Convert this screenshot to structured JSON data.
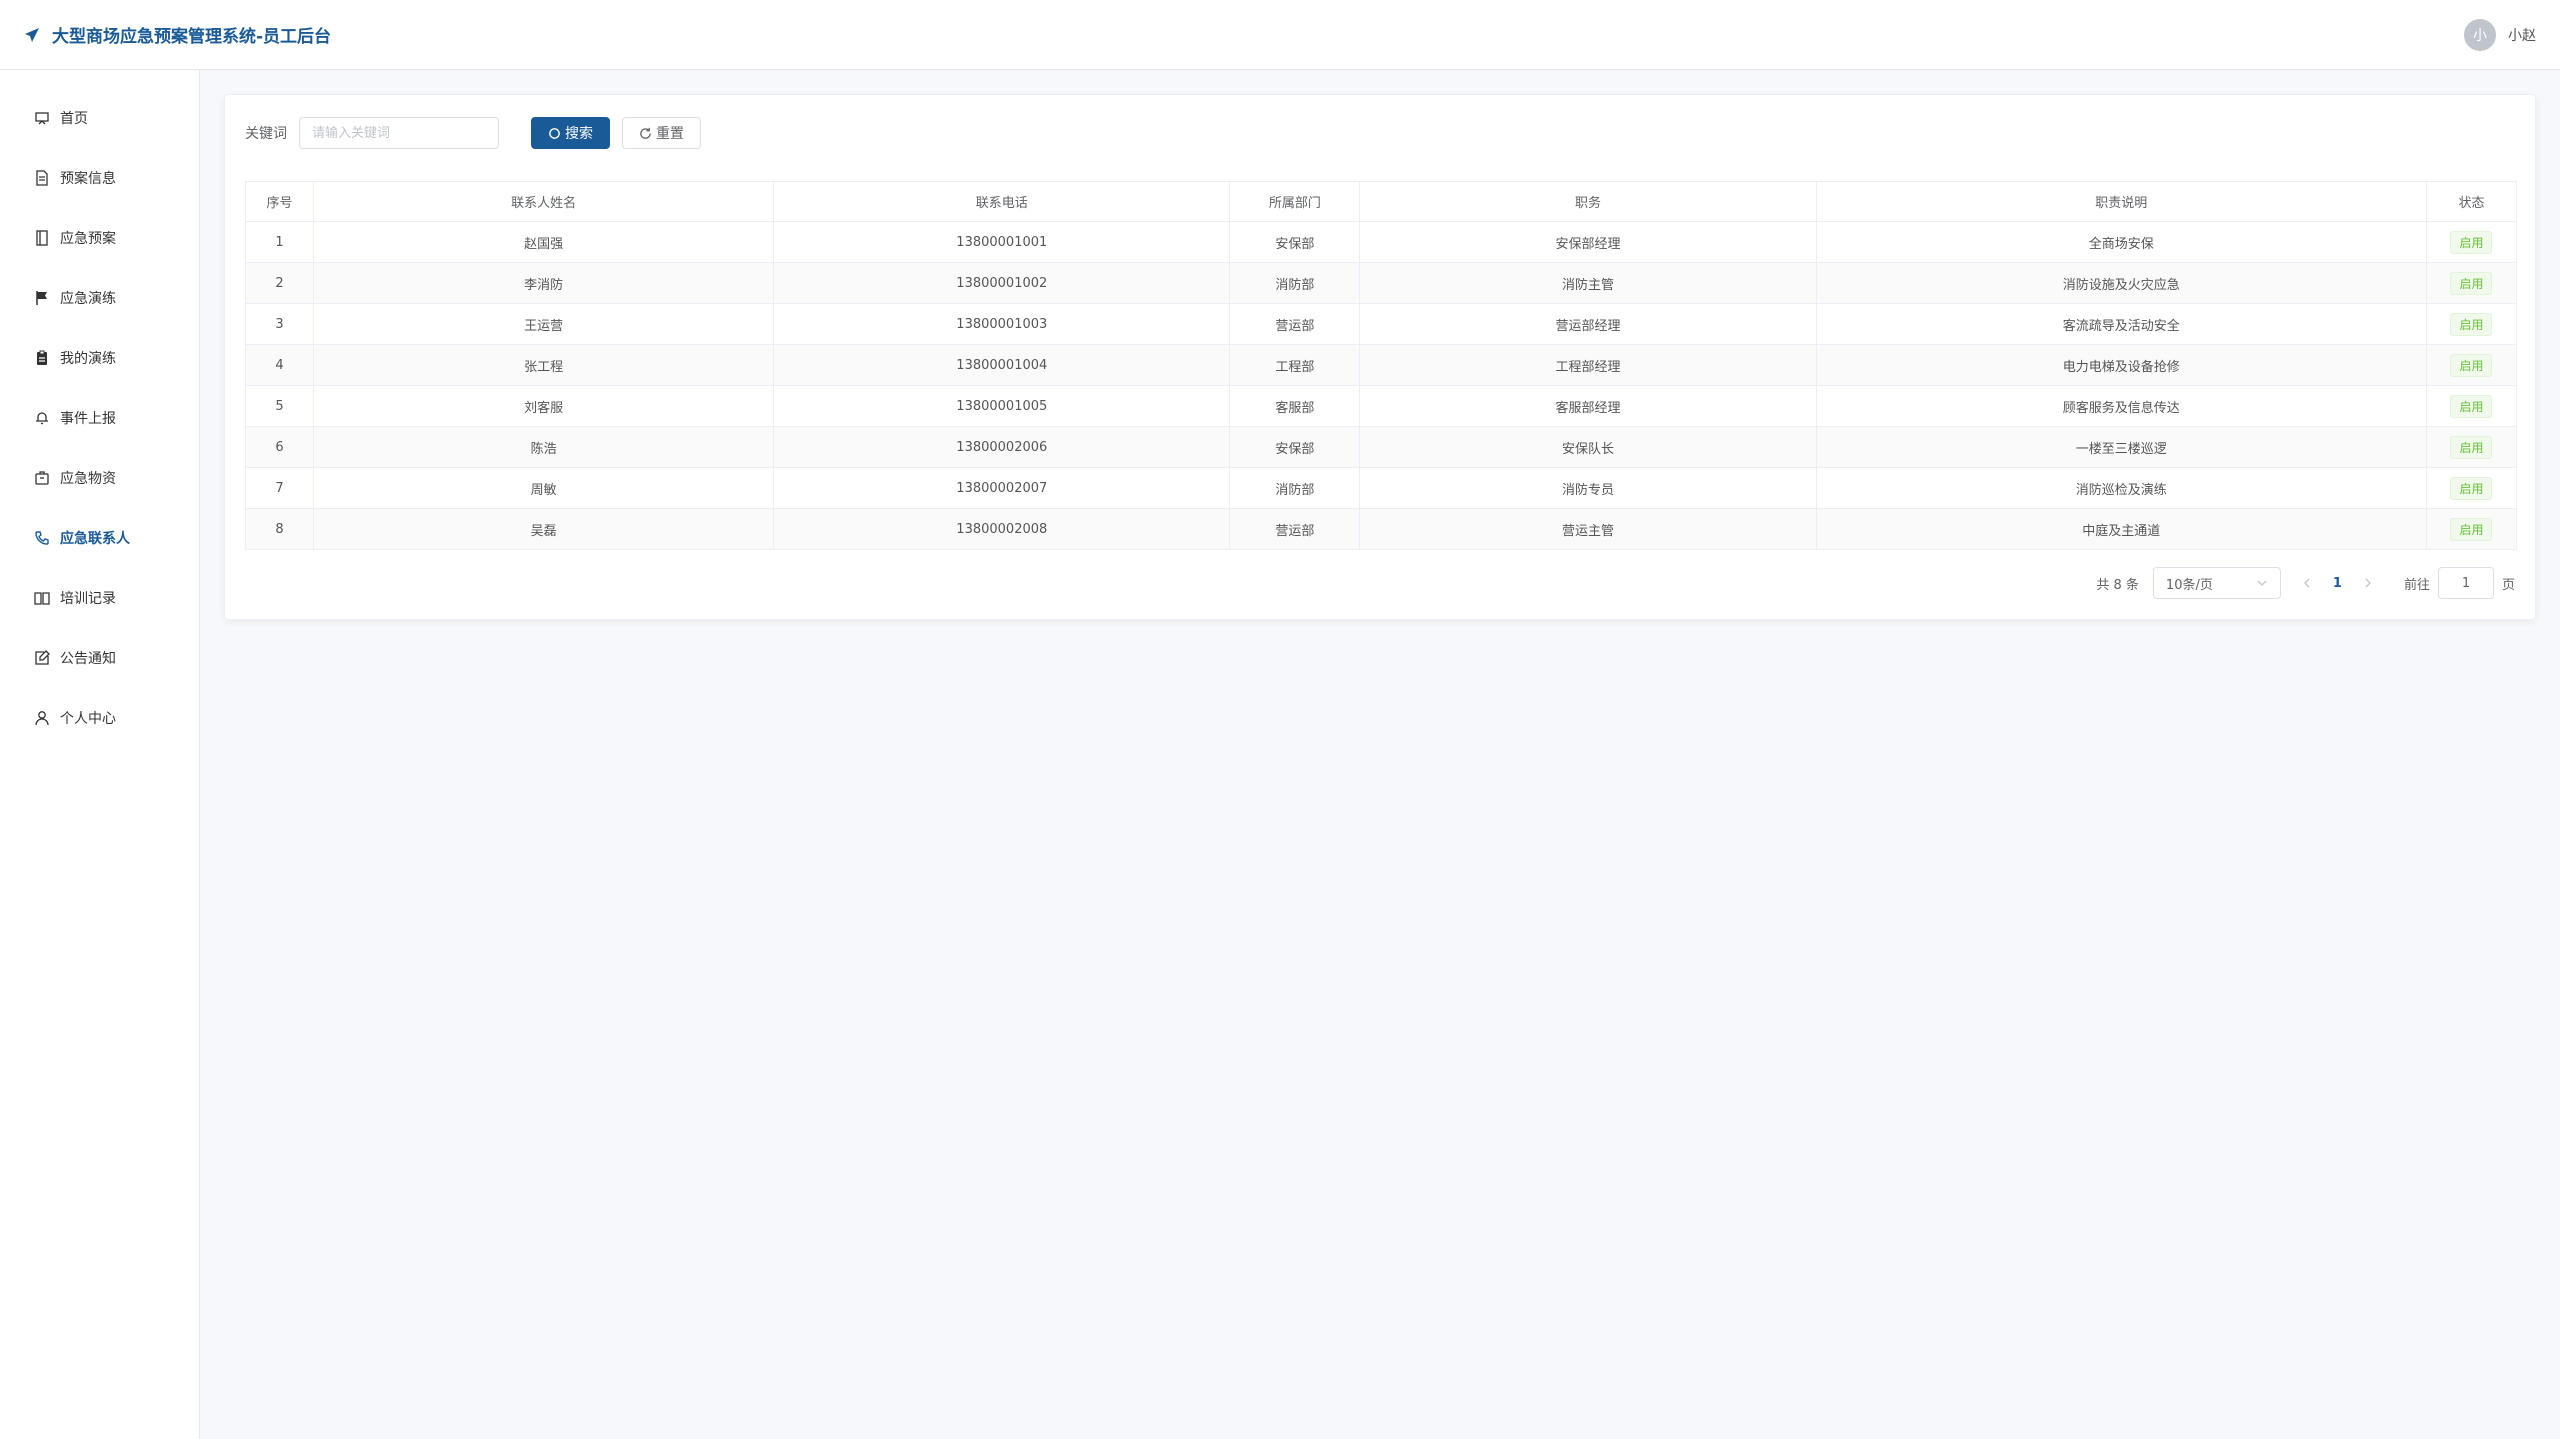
{
  "header": {
    "title": "大型商场应急预案管理系统-员工后台",
    "avatar_text": "小",
    "username": "小赵"
  },
  "sidebar": {
    "items": [
      {
        "label": "首页",
        "icon": "home-icon"
      },
      {
        "label": "预案信息",
        "icon": "document-icon"
      },
      {
        "label": "应急预案",
        "icon": "book-icon"
      },
      {
        "label": "应急演练",
        "icon": "flag-icon"
      },
      {
        "label": "我的演练",
        "icon": "clipboard-icon"
      },
      {
        "label": "事件上报",
        "icon": "bell-icon"
      },
      {
        "label": "应急物资",
        "icon": "box-icon"
      },
      {
        "label": "应急联系人",
        "icon": "phone-icon",
        "active": true
      },
      {
        "label": "培训记录",
        "icon": "open-book-icon"
      },
      {
        "label": "公告通知",
        "icon": "notice-icon"
      },
      {
        "label": "个人中心",
        "icon": "user-icon"
      }
    ]
  },
  "toolbar": {
    "keyword_label": "关键词",
    "keyword_placeholder": "请输入关键词",
    "search_label": "搜索",
    "reset_label": "重置"
  },
  "table": {
    "columns": [
      "序号",
      "联系人姓名",
      "联系电话",
      "所属部门",
      "职务",
      "职责说明",
      "状态"
    ],
    "rows": [
      [
        "1",
        "赵国强",
        "13800001001",
        "安保部",
        "安保部经理",
        "全商场安保",
        "启用"
      ],
      [
        "2",
        "李消防",
        "13800001002",
        "消防部",
        "消防主管",
        "消防设施及火灾应急",
        "启用"
      ],
      [
        "3",
        "王运营",
        "13800001003",
        "营运部",
        "营运部经理",
        "客流疏导及活动安全",
        "启用"
      ],
      [
        "4",
        "张工程",
        "13800001004",
        "工程部",
        "工程部经理",
        "电力电梯及设备抢修",
        "启用"
      ],
      [
        "5",
        "刘客服",
        "13800001005",
        "客服部",
        "客服部经理",
        "顾客服务及信息传达",
        "启用"
      ],
      [
        "6",
        "陈浩",
        "13800002006",
        "安保部",
        "安保队长",
        "一楼至三楼巡逻",
        "启用"
      ],
      [
        "7",
        "周敏",
        "13800002007",
        "消防部",
        "消防专员",
        "消防巡检及演练",
        "启用"
      ],
      [
        "8",
        "吴磊",
        "13800002008",
        "营运部",
        "营运主管",
        "中庭及主通道",
        "启用"
      ]
    ]
  },
  "pagination": {
    "total_text": "共 8 条",
    "page_size": "10条/页",
    "current_page": "1",
    "goto_label": "前往",
    "goto_value": "1",
    "goto_suffix": "页"
  },
  "colors": {
    "primary": "#1a5a96",
    "status_green": "#67c23a"
  }
}
